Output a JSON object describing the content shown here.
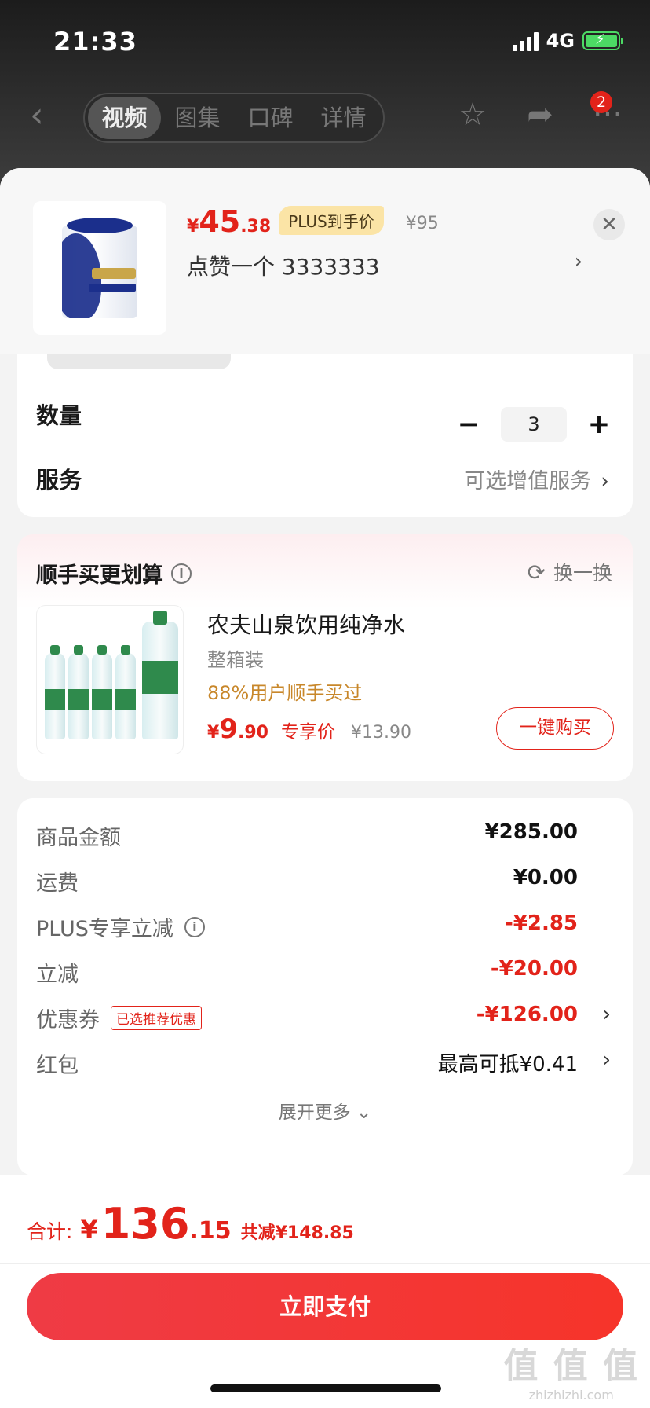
{
  "status_bar": {
    "time": "21:33",
    "network": "4G"
  },
  "nav": {
    "tabs": [
      {
        "label": "视频",
        "active": true
      },
      {
        "label": "图集",
        "active": false
      },
      {
        "label": "口碑",
        "active": false
      },
      {
        "label": "详情",
        "active": false
      }
    ],
    "badge_count": "2"
  },
  "product": {
    "price_symbol": "¥",
    "price_int": "45",
    "price_dec": ".38",
    "plus_tag": "PLUS到手价",
    "original_price": "¥95",
    "variant": "点赞一个  3333333"
  },
  "quantity": {
    "label": "数量",
    "value": "3",
    "minus": "−",
    "plus": "+"
  },
  "service": {
    "label": "服务",
    "value": "可选增值服务"
  },
  "recommend": {
    "title": "顺手买更划算",
    "swap_label": "换一换",
    "item_name": "农夫山泉饮用纯净水",
    "item_spec": "整箱装",
    "item_stat": "88%用户顺手买过",
    "price_symbol": "¥",
    "price_int": "9",
    "price_dec": ".90",
    "price_tag": "专享价",
    "original_price": "¥13.90",
    "buy_label": "一键购买"
  },
  "summary": {
    "rows": [
      {
        "label": "商品金额",
        "value": "¥285.00"
      },
      {
        "label": "运费",
        "value": "¥0.00"
      },
      {
        "label": "PLUS专享立减",
        "value": "-¥2.85"
      },
      {
        "label": "立减",
        "value": "-¥20.00"
      },
      {
        "label": "优惠券",
        "tag": "已选推荐优惠",
        "value": "-¥126.00"
      },
      {
        "label": "红包",
        "value": "最高可抵¥0.41"
      }
    ],
    "expand_label": "展开更多 ⌄"
  },
  "footer": {
    "total_label": "合计:",
    "total_symbol": "¥",
    "total_int": "136",
    "total_dec": ".15",
    "saved": "共减¥148.85",
    "pay_label": "立即支付"
  },
  "watermark": {
    "big": "值 值 值",
    "small": "zhizhizhi.com"
  },
  "colors": {
    "accent_red": "#e2231a",
    "plus_gold": "#fbe4a6",
    "stat_orange": "#c8872a"
  }
}
